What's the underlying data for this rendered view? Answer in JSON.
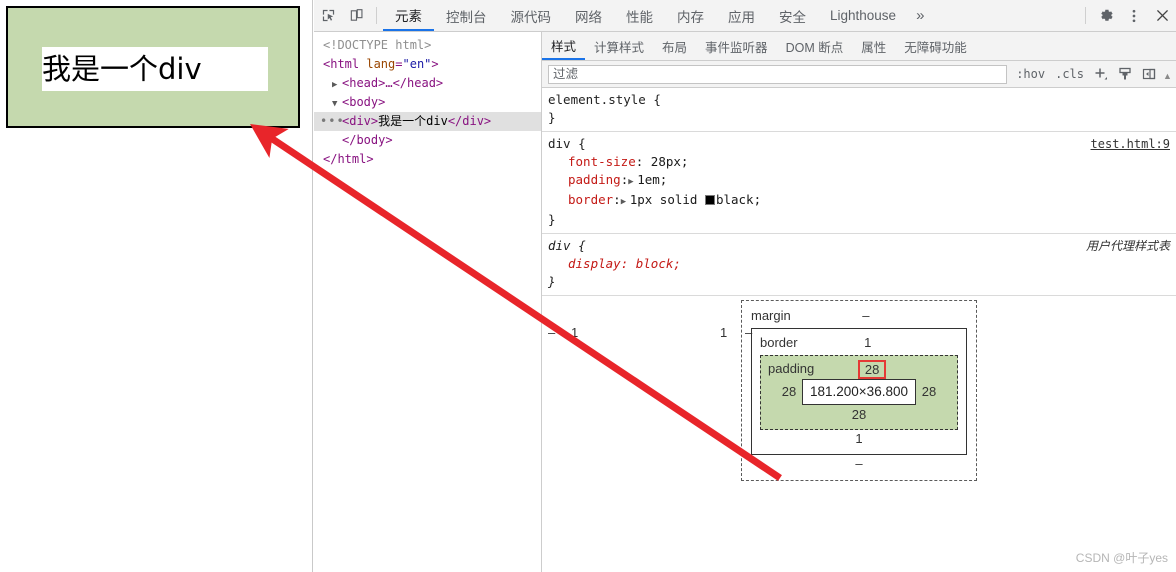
{
  "preview": {
    "div_text": "我是一个div"
  },
  "devtools": {
    "toolbar": {
      "inspect_icon": "inspect-element-icon",
      "device_icon": "device-toolbar-icon",
      "tabs": [
        {
          "label": "元素",
          "active": true
        },
        {
          "label": "控制台",
          "active": false
        },
        {
          "label": "源代码",
          "active": false
        },
        {
          "label": "网络",
          "active": false
        },
        {
          "label": "性能",
          "active": false
        },
        {
          "label": "内存",
          "active": false
        },
        {
          "label": "应用",
          "active": false
        },
        {
          "label": "安全",
          "active": false
        },
        {
          "label": "Lighthouse",
          "active": false
        }
      ],
      "more_tabs": "»",
      "settings_icon": "gear-icon",
      "menu_icon": "kebab-menu-icon",
      "close_icon": "close-icon"
    },
    "dom_tree": [
      {
        "text": "<!DOCTYPE html>",
        "type": "doctype"
      },
      {
        "text": "<html lang=\"en\">",
        "type": "element"
      },
      {
        "text": "<head>…</head>",
        "type": "collapsed"
      },
      {
        "text": "<body>",
        "type": "expanded"
      },
      {
        "text": "<div>我是一个div</div>",
        "type": "selected"
      },
      {
        "text": "</body>",
        "type": "close"
      },
      {
        "text": "</html>",
        "type": "close"
      }
    ],
    "dom_tokens": {
      "doctype": "<!DOCTYPE html>",
      "html_open_tag": "<html",
      "html_attr_name": "lang",
      "html_attr_value": "\"en\"",
      "html_close_bracket": ">",
      "head_row": "<head>…</head>",
      "body_open": "<body>",
      "div_open": "<div>",
      "div_text": "我是一个div",
      "div_close": "</div>",
      "body_close": "</body>",
      "html_close": "</html>",
      "ellipsis": "•••",
      "twisty_collapsed": "▶",
      "twisty_expanded": "▼"
    },
    "styles_tabs": [
      {
        "label": "样式",
        "active": true
      },
      {
        "label": "计算样式",
        "active": false
      },
      {
        "label": "布局",
        "active": false
      },
      {
        "label": "事件监听器",
        "active": false
      },
      {
        "label": "DOM 断点",
        "active": false
      },
      {
        "label": "属性",
        "active": false
      },
      {
        "label": "无障碍功能",
        "active": false
      }
    ],
    "filter_bar": {
      "placeholder": "过滤",
      "value": "",
      "hov_label": ":hov",
      "cls_label": ".cls",
      "new_rule_icon": "plus-icon",
      "style_icon": "paint-brush-icon",
      "sidebar_toggle_icon": "sidebar-toggle-icon",
      "scroll_up_icon": "chevron-up-icon"
    },
    "rules": [
      {
        "selector": "element.style {",
        "close": "}",
        "origin": "",
        "origin_kind": "none",
        "ua": false,
        "declarations": []
      },
      {
        "selector": "div {",
        "close": "}",
        "origin": "test.html:9",
        "origin_kind": "link",
        "ua": false,
        "declarations": [
          {
            "prop": "font-size",
            "value": "28px;",
            "expandable": false,
            "swatch": false
          },
          {
            "prop": "padding",
            "value": "1em;",
            "expandable": true,
            "swatch": false
          },
          {
            "prop": "border",
            "value": "1px solid black;",
            "expandable": true,
            "swatch": true,
            "swatch_color": "#000000"
          }
        ]
      },
      {
        "selector": "div {",
        "close": "}",
        "origin": "用户代理样式表",
        "origin_kind": "ua-label",
        "ua": true,
        "declarations": [
          {
            "prop": "display",
            "value": "block;",
            "expandable": false,
            "swatch": false
          }
        ]
      }
    ],
    "box_model": {
      "margin_label": "margin",
      "margin_top": "–",
      "margin_right": "–",
      "margin_bottom": "–",
      "margin_left": "–",
      "border_label": "border",
      "border_top": "1",
      "border_right": "1",
      "border_bottom": "1",
      "border_left": "1",
      "padding_label": "padding",
      "padding_top": "28",
      "padding_right": "28",
      "padding_bottom": "28",
      "padding_left": "28",
      "content_size": "181.200×36.800",
      "highlight_color": "#e53935",
      "padding_fill": "#c5d9ae"
    }
  },
  "annotation": {
    "arrow_color": "#e8252a"
  },
  "watermark": {
    "text": "CSDN @叶子yes"
  }
}
